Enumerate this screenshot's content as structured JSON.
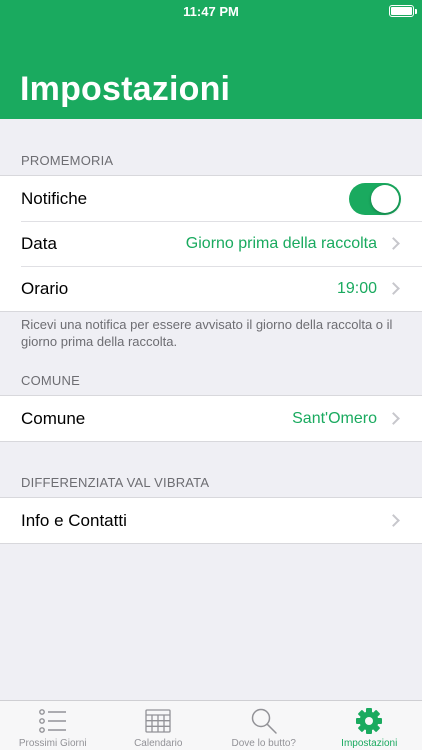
{
  "status_bar": {
    "time": "11:47 PM"
  },
  "header": {
    "title": "Impostazioni"
  },
  "sections": {
    "promemoria": {
      "label": "PROMEMORIA",
      "notifiche": {
        "label": "Notifiche",
        "enabled": true
      },
      "data": {
        "label": "Data",
        "value": "Giorno prima della raccolta"
      },
      "orario": {
        "label": "Orario",
        "value": "19:00"
      },
      "footnote": "Ricevi una notifica per essere avvisato il giorno della raccolta o il giorno prima della raccolta."
    },
    "comune": {
      "label": "COMUNE",
      "comune": {
        "label": "Comune",
        "value": "Sant'Omero"
      }
    },
    "differenziata": {
      "label": "DIFFERENZIATA VAL VIBRATA",
      "info": {
        "label": "Info e Contatti"
      }
    }
  },
  "tabbar": {
    "tabs": [
      {
        "label": "Prossimi Giorni",
        "icon": "list-icon"
      },
      {
        "label": "Calendario",
        "icon": "calendar-icon"
      },
      {
        "label": "Dove lo butto?",
        "icon": "search-icon"
      },
      {
        "label": "Impostazioni",
        "icon": "gear-icon"
      }
    ],
    "active": "Impostazioni"
  },
  "colors": {
    "accent": "#1aaa5f",
    "background": "#efeff4",
    "inactive": "#929297"
  }
}
